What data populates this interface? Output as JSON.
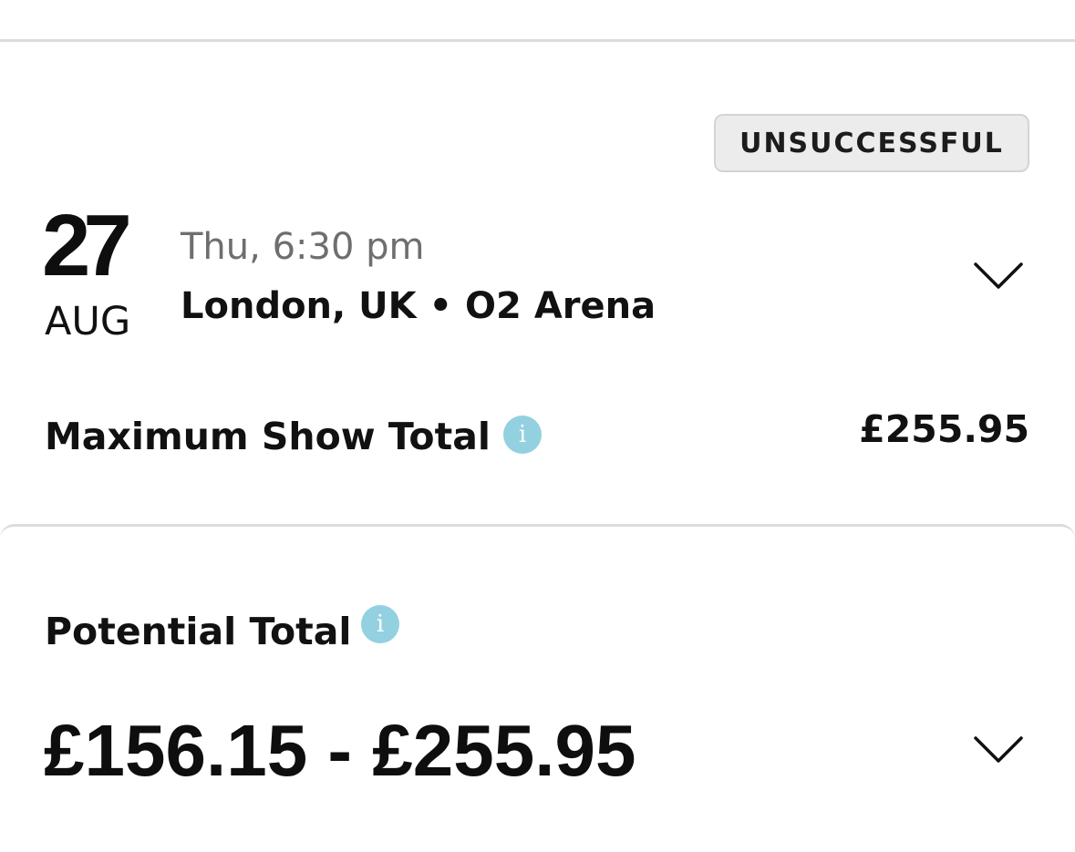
{
  "status_badge": "UNSUCCESSFUL",
  "event": {
    "day": "27",
    "month": "AUG",
    "time": "Thu, 6:30 pm",
    "location": "London, UK • O2 Arena"
  },
  "maximum_show_total": {
    "label": "Maximum Show Total",
    "value": "£255.95",
    "icon": "info-icon"
  },
  "potential_total": {
    "label": "Potential Total",
    "range": "£156.15 - £255.95",
    "icon": "info-icon"
  },
  "icons": {
    "info": "i",
    "expand": "chevron-down-icon"
  },
  "colors": {
    "info_icon": "#93d1e0",
    "badge_background": "#ececec",
    "secondary_text": "#6e6e6e"
  }
}
